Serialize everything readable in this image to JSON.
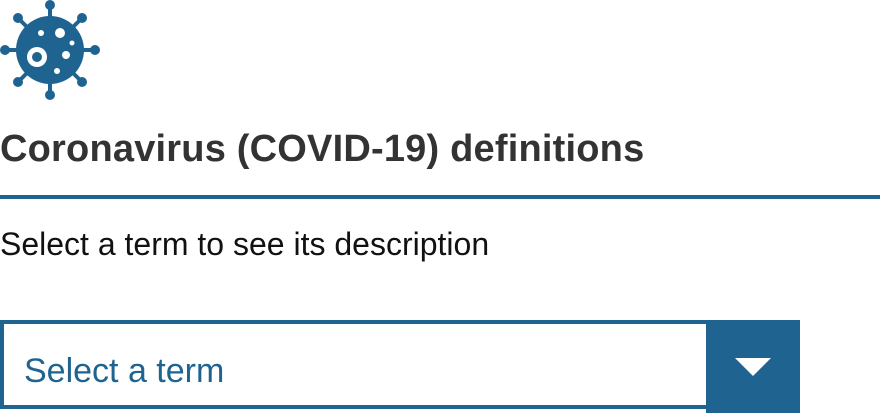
{
  "header": {
    "logo_icon": "coronavirus-icon",
    "title": "Coronavirus (COVID-19) definitions"
  },
  "instruction": "Select a term to see its description",
  "term_select": {
    "placeholder": "Select a term",
    "button_icon": "chevron-down-icon"
  },
  "colors": {
    "accent": "#1f6391",
    "text": "#333333",
    "background": "#ffffff"
  }
}
